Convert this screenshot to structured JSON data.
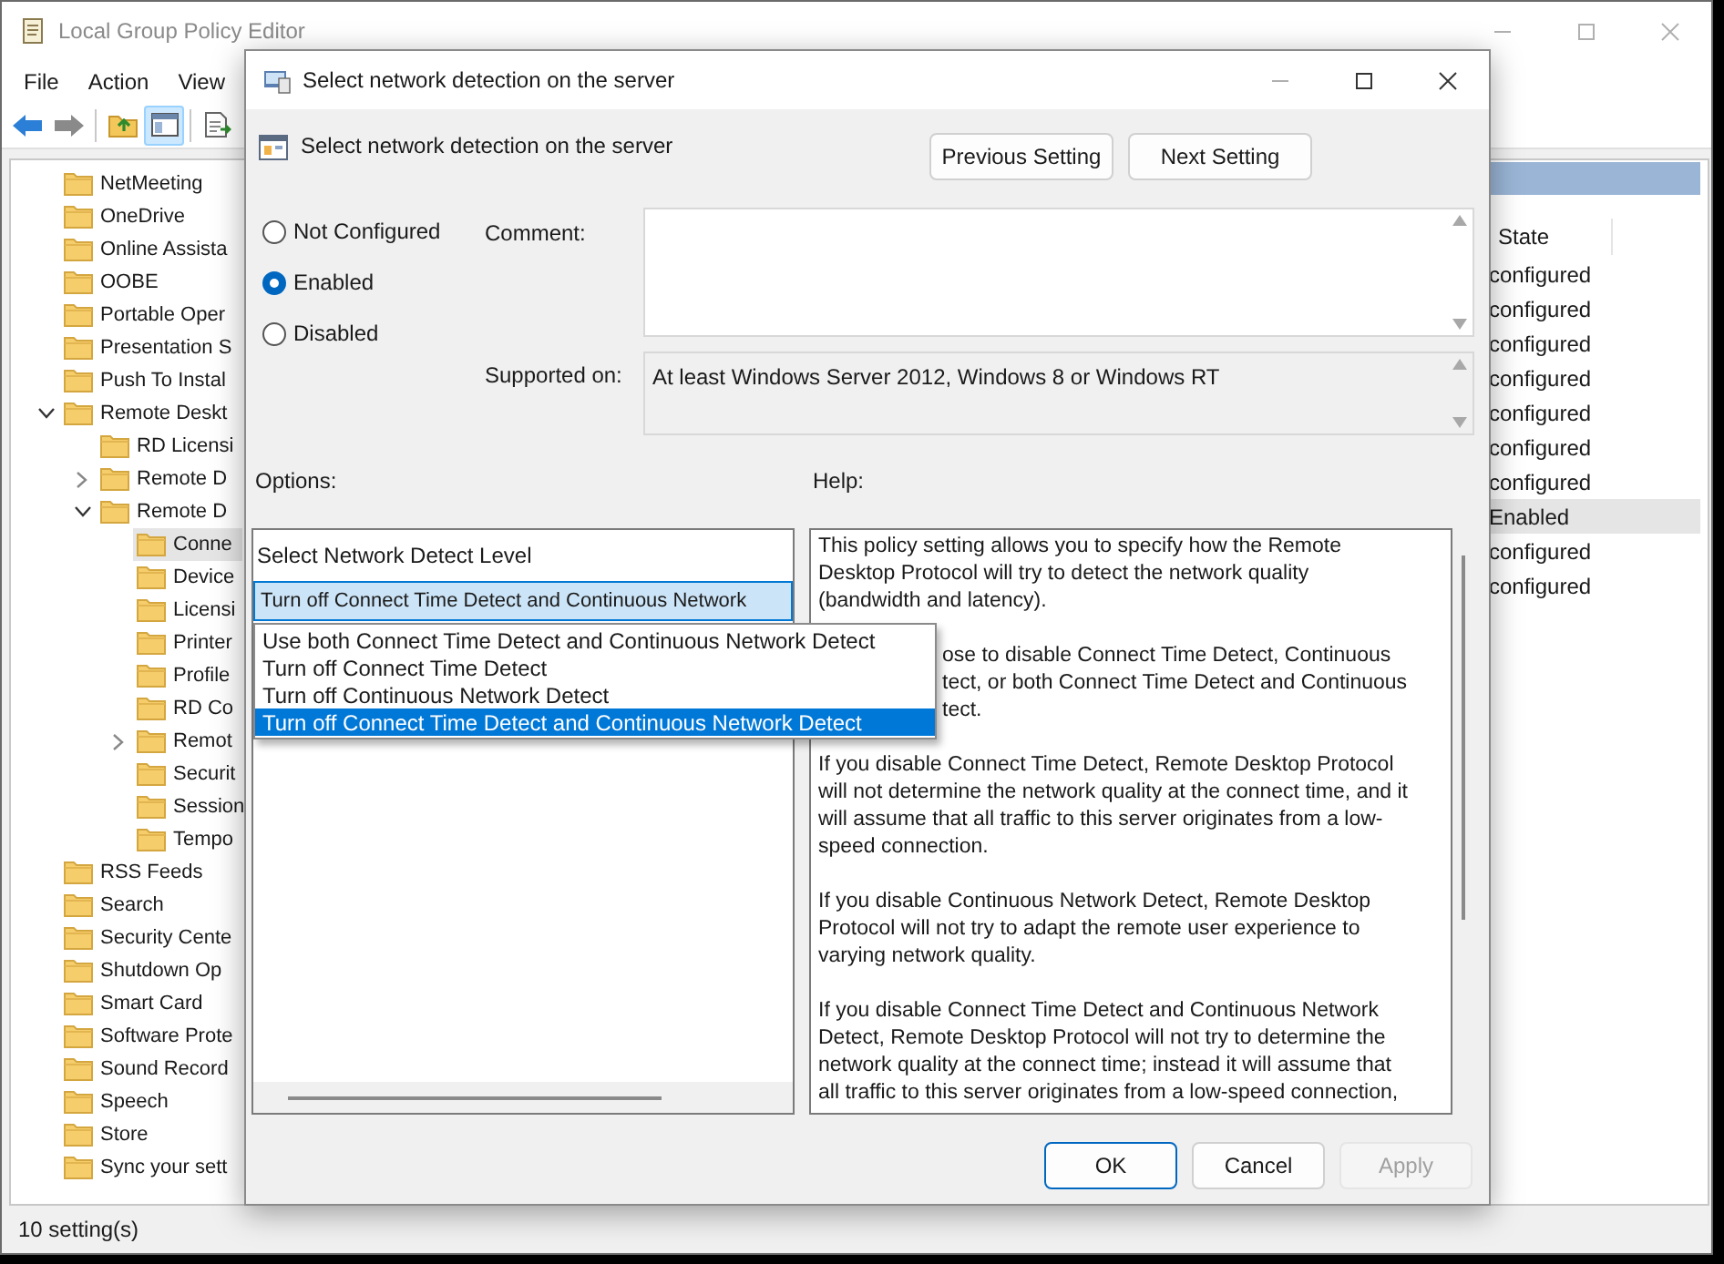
{
  "window": {
    "title": "Local Group Policy Editor"
  },
  "menu": [
    "File",
    "Action",
    "View"
  ],
  "toolbar": [
    {
      "kind": "back",
      "disabled": false,
      "pressed": false
    },
    {
      "kind": "forward",
      "disabled": true,
      "pressed": false
    },
    {
      "kind": "up",
      "pressed": false
    },
    {
      "kind": "pane",
      "pressed": true
    },
    {
      "kind": "export",
      "pressed": false
    }
  ],
  "tree": [
    {
      "label": "NetMeeting",
      "selected": false
    },
    {
      "label": "OneDrive",
      "selected": false
    },
    {
      "label": "Online Assista",
      "selected": false
    },
    {
      "label": "OOBE",
      "selected": false
    },
    {
      "label": "Portable Oper",
      "selected": false
    },
    {
      "label": "Presentation S",
      "selected": false
    },
    {
      "label": "Push To Instal",
      "selected": false
    },
    {
      "label": "Remote Deskt",
      "selected": false,
      "expanded": true,
      "children": [
        {
          "label": "RD Licensi",
          "selected": false
        },
        {
          "label": "Remote D",
          "selected": false,
          "expanded": false
        },
        {
          "label": "Remote D",
          "selected": false,
          "expanded": true,
          "children": [
            {
              "label": "Conne",
              "selected": true
            },
            {
              "label": "Device",
              "selected": false
            },
            {
              "label": "Licensi",
              "selected": false
            },
            {
              "label": "Printer",
              "selected": false
            },
            {
              "label": "Profile",
              "selected": false
            },
            {
              "label": "RD Co",
              "selected": false
            },
            {
              "label": "Remot",
              "selected": false,
              "expanded": false
            },
            {
              "label": "Securit",
              "selected": false
            },
            {
              "label": "Session",
              "selected": false
            },
            {
              "label": "Tempo",
              "selected": false
            }
          ]
        }
      ]
    },
    {
      "label": "RSS Feeds",
      "selected": false
    },
    {
      "label": "Search",
      "selected": false
    },
    {
      "label": "Security Cente",
      "selected": false
    },
    {
      "label": "Shutdown Op",
      "selected": false
    },
    {
      "label": "Smart Card",
      "selected": false
    },
    {
      "label": "Software Prote",
      "selected": false
    },
    {
      "label": "Sound Record",
      "selected": false
    },
    {
      "label": "Speech",
      "selected": false
    },
    {
      "label": "Store",
      "selected": false
    },
    {
      "label": "Sync your sett",
      "selected": false
    }
  ],
  "list": {
    "columns": [
      "State"
    ],
    "rows": [
      {
        "state": "configured",
        "selected": false
      },
      {
        "state": "configured",
        "selected": false
      },
      {
        "state": "configured",
        "selected": false
      },
      {
        "state": "configured",
        "selected": false
      },
      {
        "state": "configured",
        "selected": false
      },
      {
        "state": "configured",
        "selected": false
      },
      {
        "state": "configured",
        "selected": false
      },
      {
        "state": "Enabled",
        "selected": true
      },
      {
        "state": "configured",
        "selected": false
      },
      {
        "state": "configured",
        "selected": false
      }
    ]
  },
  "status_bar": "10 setting(s)",
  "dialog": {
    "title": "Select network detection on the server",
    "heading": "Select network detection on the server",
    "nav_buttons": [
      "Previous Setting",
      "Next Setting"
    ],
    "radios": [
      {
        "label": "Not Configured",
        "selected": false
      },
      {
        "label": "Enabled",
        "selected": true
      },
      {
        "label": "Disabled",
        "selected": false
      }
    ],
    "comment_label": "Comment:",
    "supported_label": "Supported on:",
    "supported_value": "At least Windows Server 2012, Windows 8 or Windows RT",
    "options_label": "Options:",
    "help_label": "Help:",
    "option": {
      "label": "Select Network Detect Level",
      "value": "Turn off Connect Time Detect and Continuous Network",
      "dropdown": [
        {
          "label": "Use both Connect Time Detect and Continuous Network Detect",
          "selected": false
        },
        {
          "label": "Turn off Connect Time Detect",
          "selected": false
        },
        {
          "label": "Turn off Continuous Network Detect",
          "selected": false
        },
        {
          "label": "Turn off Connect Time Detect and Continuous Network Detect",
          "selected": true
        }
      ]
    },
    "help": [
      {
        "lines": [
          "This policy setting allows you to specify how the Remote",
          "Desktop Protocol will try to detect the network quality",
          "(bandwidth and latency)."
        ]
      },
      {
        "kind": "partly_covered",
        "lines": [
          "ose to disable Connect Time Detect, Continuous",
          "tect, or both Connect Time Detect and Continuous",
          "tect."
        ]
      },
      {
        "lines": [
          "If you disable Connect Time Detect, Remote Desktop Protocol",
          "will not determine the network quality at the connect time, and it",
          "will assume that all traffic to this server originates from a low-",
          "speed connection."
        ]
      },
      {
        "lines": [
          "If you disable Continuous Network Detect, Remote Desktop",
          "Protocol will not try to adapt the remote user experience to",
          "varying network quality."
        ]
      },
      {
        "lines": [
          "If you disable Connect Time Detect and Continuous Network",
          "Detect, Remote Desktop Protocol will not try to determine the",
          "network quality at the connect time; instead it will assume that",
          "all traffic to this server originates from a low-speed connection,"
        ]
      }
    ],
    "buttons": [
      {
        "label": "OK",
        "default": true,
        "disabled": false
      },
      {
        "label": "Cancel",
        "default": false,
        "disabled": false
      },
      {
        "label": "Apply",
        "default": false,
        "disabled": true
      }
    ]
  }
}
